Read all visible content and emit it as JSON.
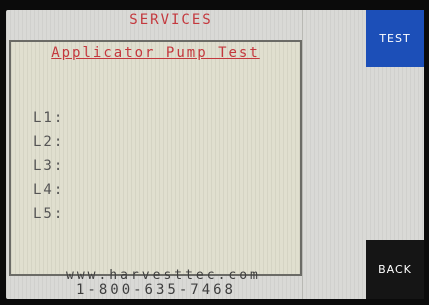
{
  "header": {
    "title": "SERVICES"
  },
  "panel": {
    "title": "Applicator Pump Test",
    "lines": [
      "L1:",
      "L2:",
      "L3:",
      "L4:",
      "L5:"
    ]
  },
  "buttons": {
    "test": "TEST",
    "back": "BACK"
  },
  "footer": {
    "website": "www.harvesttec.com",
    "phone": "1-800-635-7468"
  },
  "colors": {
    "title_red": "#c4383d",
    "test_button": "#1c4fb8",
    "back_button": "#151515",
    "screen_bg": "#d9d9d6"
  }
}
